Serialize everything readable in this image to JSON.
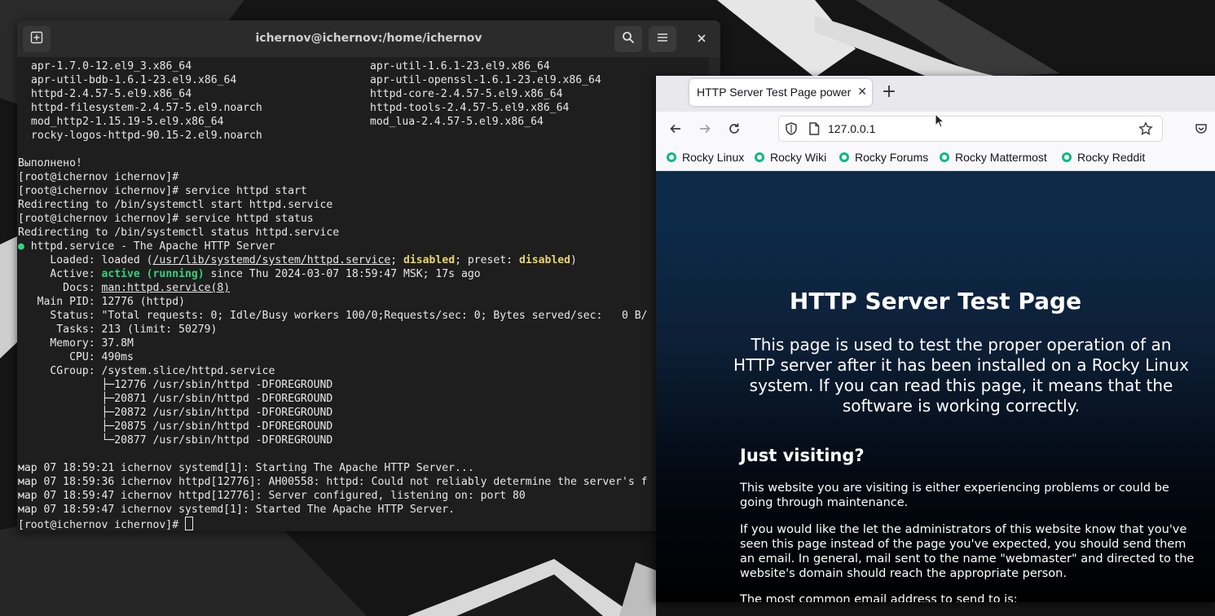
{
  "terminal": {
    "title": "ichernov@ichernov:/home/ichernov",
    "packages": [
      [
        "apr-1.7.0-12.el9_3.x86_64",
        "apr-util-1.6.1-23.el9.x86_64"
      ],
      [
        "apr-util-bdb-1.6.1-23.el9.x86_64",
        "apr-util-openssl-1.6.1-23.el9.x86_64"
      ],
      [
        "httpd-2.4.57-5.el9.x86_64",
        "httpd-core-2.4.57-5.el9.x86_64"
      ],
      [
        "httpd-filesystem-2.4.57-5.el9.noarch",
        "httpd-tools-2.4.57-5.el9.x86_64"
      ],
      [
        "mod_http2-1.15.19-5.el9.x86_64",
        "mod_lua-2.4.57-5.el9.x86_64"
      ],
      [
        "rocky-logos-httpd-90.15-2.el9.noarch",
        ""
      ]
    ],
    "done": "Выполнено!",
    "prompt1": "[root@ichernov ichernov]#",
    "prompt2": "[root@ichernov ichernov]# service httpd start",
    "redirect1": "Redirecting to /bin/systemctl start httpd.service",
    "prompt3": "[root@ichernov ichernov]# service httpd status",
    "redirect2": "Redirecting to /bin/systemctl status httpd.service",
    "service_dot": "●",
    "service_line": " httpd.service - The Apache HTTP Server",
    "loaded_a": "     Loaded: loaded (",
    "loaded_path": "/usr/lib/systemd/system/httpd.service",
    "loaded_b": "; ",
    "loaded_disabled1": "disabled",
    "loaded_c": "; preset: ",
    "loaded_disabled2": "disabled",
    "loaded_d": ")",
    "active_a": "     Active: ",
    "active_state": "active (running)",
    "active_b": " since Thu 2024-03-07 18:59:47 MSK; 17s ago",
    "docs_a": "       Docs: ",
    "docs_link": "man:httpd.service(8)",
    "mainpid": "   Main PID: 12776 (httpd)",
    "status": "     Status: \"Total requests: 0; Idle/Busy workers 100/0;Requests/sec: 0; Bytes served/sec:   0 B/",
    "tasks": "      Tasks: 213 (limit: 50279)",
    "memory": "     Memory: 37.8M",
    "cpu": "        CPU: 490ms",
    "cgroup": "     CGroup: /system.slice/httpd.service",
    "tree": [
      "             ├─12776 /usr/sbin/httpd -DFOREGROUND",
      "             ├─20871 /usr/sbin/httpd -DFOREGROUND",
      "             ├─20872 /usr/sbin/httpd -DFOREGROUND",
      "             ├─20875 /usr/sbin/httpd -DFOREGROUND",
      "             └─20877 /usr/sbin/httpd -DFOREGROUND"
    ],
    "log": [
      "мар 07 18:59:21 ichernov systemd[1]: Starting The Apache HTTP Server...",
      "мар 07 18:59:36 ichernov httpd[12776]: AH00558: httpd: Could not reliably determine the server's f",
      "мар 07 18:59:47 ichernov httpd[12776]: Server configured, listening on: port 80",
      "мар 07 18:59:47 ichernov systemd[1]: Started The Apache HTTP Server."
    ],
    "final_prompt": "[root@ichernov ichernov]# "
  },
  "browser": {
    "tab_title": "HTTP Server Test Page powered by Rocky Linux",
    "url": "127.0.0.1",
    "bookmarks": [
      "Rocky Linux",
      "Rocky Wiki",
      "Rocky Forums",
      "Rocky Mattermost",
      "Rocky Reddit"
    ],
    "page": {
      "title": "HTTP Server Test Page",
      "lead": "This page is used to test the proper operation of an HTTP server after it has been installed on a Rocky Linux system. If you can read this page, it means that the software is working correctly.",
      "h2": "Just visiting?",
      "p1": "This website you are visiting is either experiencing problems or could be going through maintenance.",
      "p2": "If you would like the let the administrators of this website know that you've seen this page instead of the page you've expected, you should send them an email. In general, mail sent to the name \"webmaster\" and directed to the website's domain should reach the appropriate person.",
      "p3": "The most common email address to send to is:"
    }
  },
  "colors": {
    "terminal_bg": "#1e1e1e",
    "accent_green": "#33d17a",
    "accent_yellow": "#e9d36b",
    "bookmark_leaf": "#10b981"
  }
}
